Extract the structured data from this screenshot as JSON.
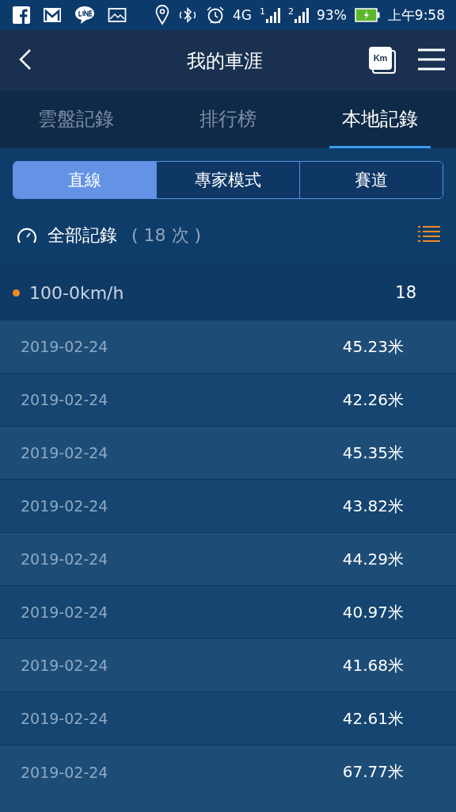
{
  "status_bar": {
    "network": "4G",
    "sim_1": "1",
    "sim_2": "2",
    "battery": "93%",
    "time": "上午9:58"
  },
  "header": {
    "title": "我的車涯",
    "unit_badge": "Km"
  },
  "tabs": [
    {
      "label": "雲盤記錄",
      "selected": false
    },
    {
      "label": "排行榜",
      "selected": false
    },
    {
      "label": "本地記錄",
      "selected": true
    }
  ],
  "segments": [
    {
      "label": "直線",
      "selected": true
    },
    {
      "label": "專家模式",
      "selected": false
    },
    {
      "label": "賽道",
      "selected": false
    }
  ],
  "summary": {
    "title": "全部記錄",
    "count": "( 18 次 )"
  },
  "group": {
    "name": "100-0km/h",
    "count": "18"
  },
  "rows": [
    {
      "date": "2019-02-24",
      "distance": "45.23米"
    },
    {
      "date": "2019-02-24",
      "distance": "42.26米"
    },
    {
      "date": "2019-02-24",
      "distance": "45.35米"
    },
    {
      "date": "2019-02-24",
      "distance": "43.82米"
    },
    {
      "date": "2019-02-24",
      "distance": "44.29米"
    },
    {
      "date": "2019-02-24",
      "distance": "40.97米"
    },
    {
      "date": "2019-02-24",
      "distance": "41.68米"
    },
    {
      "date": "2019-02-24",
      "distance": "42.61米"
    },
    {
      "date": "2019-02-24",
      "distance": "67.77米"
    }
  ]
}
